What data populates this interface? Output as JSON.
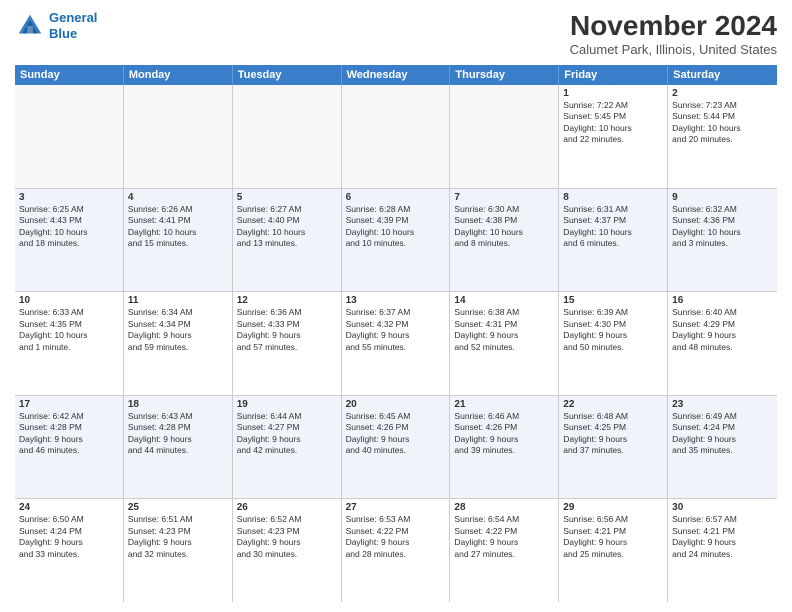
{
  "header": {
    "logo_line1": "General",
    "logo_line2": "Blue",
    "title": "November 2024",
    "subtitle": "Calumet Park, Illinois, United States"
  },
  "days_of_week": [
    "Sunday",
    "Monday",
    "Tuesday",
    "Wednesday",
    "Thursday",
    "Friday",
    "Saturday"
  ],
  "rows": [
    {
      "alt": false,
      "cells": [
        {
          "empty": true,
          "day": "",
          "info": ""
        },
        {
          "empty": true,
          "day": "",
          "info": ""
        },
        {
          "empty": true,
          "day": "",
          "info": ""
        },
        {
          "empty": true,
          "day": "",
          "info": ""
        },
        {
          "empty": true,
          "day": "",
          "info": ""
        },
        {
          "empty": false,
          "day": "1",
          "info": "Sunrise: 7:22 AM\nSunset: 5:45 PM\nDaylight: 10 hours\nand 22 minutes."
        },
        {
          "empty": false,
          "day": "2",
          "info": "Sunrise: 7:23 AM\nSunset: 5:44 PM\nDaylight: 10 hours\nand 20 minutes."
        }
      ]
    },
    {
      "alt": true,
      "cells": [
        {
          "empty": false,
          "day": "3",
          "info": "Sunrise: 6:25 AM\nSunset: 4:43 PM\nDaylight: 10 hours\nand 18 minutes."
        },
        {
          "empty": false,
          "day": "4",
          "info": "Sunrise: 6:26 AM\nSunset: 4:41 PM\nDaylight: 10 hours\nand 15 minutes."
        },
        {
          "empty": false,
          "day": "5",
          "info": "Sunrise: 6:27 AM\nSunset: 4:40 PM\nDaylight: 10 hours\nand 13 minutes."
        },
        {
          "empty": false,
          "day": "6",
          "info": "Sunrise: 6:28 AM\nSunset: 4:39 PM\nDaylight: 10 hours\nand 10 minutes."
        },
        {
          "empty": false,
          "day": "7",
          "info": "Sunrise: 6:30 AM\nSunset: 4:38 PM\nDaylight: 10 hours\nand 8 minutes."
        },
        {
          "empty": false,
          "day": "8",
          "info": "Sunrise: 6:31 AM\nSunset: 4:37 PM\nDaylight: 10 hours\nand 6 minutes."
        },
        {
          "empty": false,
          "day": "9",
          "info": "Sunrise: 6:32 AM\nSunset: 4:36 PM\nDaylight: 10 hours\nand 3 minutes."
        }
      ]
    },
    {
      "alt": false,
      "cells": [
        {
          "empty": false,
          "day": "10",
          "info": "Sunrise: 6:33 AM\nSunset: 4:35 PM\nDaylight: 10 hours\nand 1 minute."
        },
        {
          "empty": false,
          "day": "11",
          "info": "Sunrise: 6:34 AM\nSunset: 4:34 PM\nDaylight: 9 hours\nand 59 minutes."
        },
        {
          "empty": false,
          "day": "12",
          "info": "Sunrise: 6:36 AM\nSunset: 4:33 PM\nDaylight: 9 hours\nand 57 minutes."
        },
        {
          "empty": false,
          "day": "13",
          "info": "Sunrise: 6:37 AM\nSunset: 4:32 PM\nDaylight: 9 hours\nand 55 minutes."
        },
        {
          "empty": false,
          "day": "14",
          "info": "Sunrise: 6:38 AM\nSunset: 4:31 PM\nDaylight: 9 hours\nand 52 minutes."
        },
        {
          "empty": false,
          "day": "15",
          "info": "Sunrise: 6:39 AM\nSunset: 4:30 PM\nDaylight: 9 hours\nand 50 minutes."
        },
        {
          "empty": false,
          "day": "16",
          "info": "Sunrise: 6:40 AM\nSunset: 4:29 PM\nDaylight: 9 hours\nand 48 minutes."
        }
      ]
    },
    {
      "alt": true,
      "cells": [
        {
          "empty": false,
          "day": "17",
          "info": "Sunrise: 6:42 AM\nSunset: 4:28 PM\nDaylight: 9 hours\nand 46 minutes."
        },
        {
          "empty": false,
          "day": "18",
          "info": "Sunrise: 6:43 AM\nSunset: 4:28 PM\nDaylight: 9 hours\nand 44 minutes."
        },
        {
          "empty": false,
          "day": "19",
          "info": "Sunrise: 6:44 AM\nSunset: 4:27 PM\nDaylight: 9 hours\nand 42 minutes."
        },
        {
          "empty": false,
          "day": "20",
          "info": "Sunrise: 6:45 AM\nSunset: 4:26 PM\nDaylight: 9 hours\nand 40 minutes."
        },
        {
          "empty": false,
          "day": "21",
          "info": "Sunrise: 6:46 AM\nSunset: 4:26 PM\nDaylight: 9 hours\nand 39 minutes."
        },
        {
          "empty": false,
          "day": "22",
          "info": "Sunrise: 6:48 AM\nSunset: 4:25 PM\nDaylight: 9 hours\nand 37 minutes."
        },
        {
          "empty": false,
          "day": "23",
          "info": "Sunrise: 6:49 AM\nSunset: 4:24 PM\nDaylight: 9 hours\nand 35 minutes."
        }
      ]
    },
    {
      "alt": false,
      "cells": [
        {
          "empty": false,
          "day": "24",
          "info": "Sunrise: 6:50 AM\nSunset: 4:24 PM\nDaylight: 9 hours\nand 33 minutes."
        },
        {
          "empty": false,
          "day": "25",
          "info": "Sunrise: 6:51 AM\nSunset: 4:23 PM\nDaylight: 9 hours\nand 32 minutes."
        },
        {
          "empty": false,
          "day": "26",
          "info": "Sunrise: 6:52 AM\nSunset: 4:23 PM\nDaylight: 9 hours\nand 30 minutes."
        },
        {
          "empty": false,
          "day": "27",
          "info": "Sunrise: 6:53 AM\nSunset: 4:22 PM\nDaylight: 9 hours\nand 28 minutes."
        },
        {
          "empty": false,
          "day": "28",
          "info": "Sunrise: 6:54 AM\nSunset: 4:22 PM\nDaylight: 9 hours\nand 27 minutes."
        },
        {
          "empty": false,
          "day": "29",
          "info": "Sunrise: 6:56 AM\nSunset: 4:21 PM\nDaylight: 9 hours\nand 25 minutes."
        },
        {
          "empty": false,
          "day": "30",
          "info": "Sunrise: 6:57 AM\nSunset: 4:21 PM\nDaylight: 9 hours\nand 24 minutes."
        }
      ]
    }
  ]
}
